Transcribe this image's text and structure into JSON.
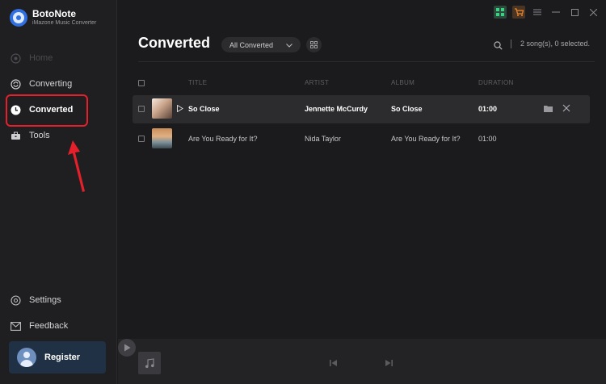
{
  "app": {
    "name": "BotoNote",
    "subtitle": "iMazone Music Converter"
  },
  "sidebar": {
    "items": [
      {
        "label": "Home",
        "icon": "home-icon"
      },
      {
        "label": "Converting",
        "icon": "converting-icon"
      },
      {
        "label": "Converted",
        "icon": "clock-icon"
      },
      {
        "label": "Tools",
        "icon": "toolbox-icon"
      }
    ],
    "settings_label": "Settings",
    "feedback_label": "Feedback",
    "register_label": "Register"
  },
  "header": {
    "title": "Converted",
    "filter_value": "All Converted",
    "selection_status": "2 song(s), 0 selected."
  },
  "table": {
    "columns": [
      "TITLE",
      "ARTIST",
      "ALBUM",
      "DURATION"
    ],
    "rows": [
      {
        "title": "So Close",
        "artist": "Jennette McCurdy",
        "album": "So Close",
        "duration": "01:00"
      },
      {
        "title": "Are You Ready for It?",
        "artist": "Nida Taylor",
        "album": "Are You Ready for It?",
        "duration": "01:00"
      }
    ]
  },
  "colors": {
    "accent": "#2f6fe0",
    "highlight": "#e5202a",
    "background": "#1b1b1d"
  }
}
